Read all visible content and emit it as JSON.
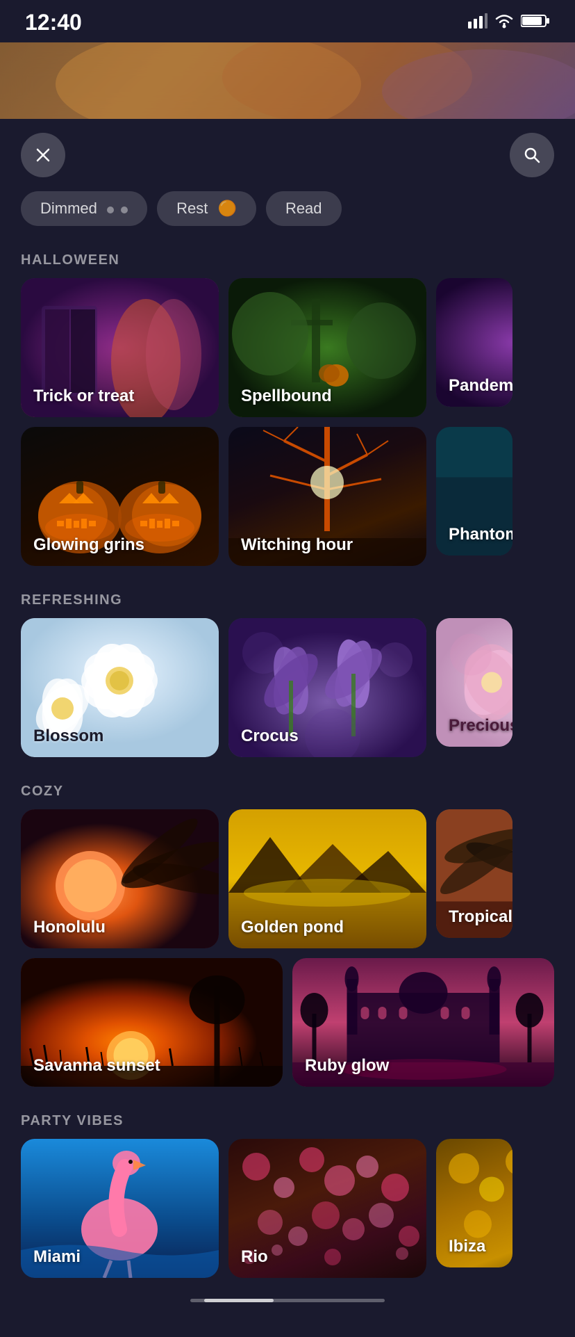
{
  "statusBar": {
    "time": "12:40"
  },
  "header": {
    "close_label": "×",
    "search_label": "🔍"
  },
  "chips": [
    {
      "label": "Dimmed"
    },
    {
      "label": "Rest"
    },
    {
      "label": "Read"
    }
  ],
  "sections": [
    {
      "id": "halloween",
      "title": "HALLOWEEN",
      "rows": [
        [
          {
            "id": "trick",
            "label": "Trick or treat",
            "bg": "bg-trick"
          },
          {
            "id": "spellbound",
            "label": "Spellbound",
            "bg": "bg-spellbound"
          },
          {
            "id": "pandemo",
            "label": "Pandemo",
            "bg": "bg-pandemo",
            "partial": true
          }
        ],
        [
          {
            "id": "glowing",
            "label": "Glowing grins",
            "bg": "bg-glowing"
          },
          {
            "id": "witching",
            "label": "Witching hour",
            "bg": "bg-witching"
          },
          {
            "id": "phantom",
            "label": "Phantom",
            "bg": "bg-phantom",
            "partial": true
          }
        ]
      ]
    },
    {
      "id": "refreshing",
      "title": "REFRESHING",
      "rows": [
        [
          {
            "id": "blossom",
            "label": "Blossom",
            "bg": "bg-blossom"
          },
          {
            "id": "crocus",
            "label": "Crocus",
            "bg": "bg-crocus"
          },
          {
            "id": "precious",
            "label": "Precious",
            "bg": "bg-precious",
            "partial": true
          }
        ]
      ]
    },
    {
      "id": "cozy",
      "title": "COZY",
      "rows": [
        [
          {
            "id": "honolulu",
            "label": "Honolulu",
            "bg": "bg-honolulu"
          },
          {
            "id": "golden",
            "label": "Golden pond",
            "bg": "bg-golden"
          },
          {
            "id": "tropical",
            "label": "Tropical t",
            "bg": "bg-tropical",
            "partial": true
          }
        ],
        [
          {
            "id": "savanna",
            "label": "Savanna sunset",
            "bg": "bg-savanna"
          },
          {
            "id": "ruby",
            "label": "Ruby glow",
            "bg": "bg-ruby"
          }
        ]
      ]
    },
    {
      "id": "party",
      "title": "PARTY VIBES",
      "rows": [
        [
          {
            "id": "miami",
            "label": "Miami",
            "bg": "bg-miami"
          },
          {
            "id": "rio",
            "label": "Rio",
            "bg": "bg-rio"
          },
          {
            "id": "ibiza",
            "label": "Ibiza",
            "bg": "bg-ibiza",
            "partial": true
          }
        ]
      ]
    }
  ],
  "scrollbar": {
    "visible": true
  }
}
